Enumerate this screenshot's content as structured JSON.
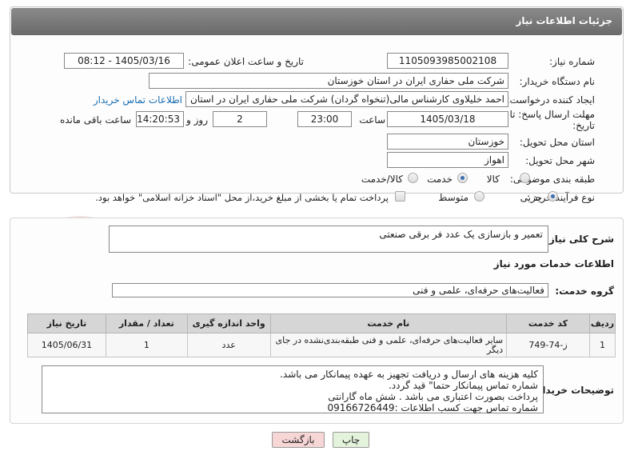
{
  "header": {
    "title": "جزئیات اطلاعات نیاز"
  },
  "form": {
    "need_number_label": "شماره نیاز:",
    "need_number": "1105093985002108",
    "announce_label": "تاریخ و ساعت اعلان عمومی:",
    "announce_value": "1405/03/16 - 08:12",
    "buyer_org_label": "نام دستگاه خریدار:",
    "buyer_org": "شرکت ملی حفاری ایران در استان خوزستان",
    "requester_label": "ایجاد کننده درخواست:",
    "requester": "احمد خلیلاوی کارشناس مالی(تنخواه گردان) شرکت ملی حفاری ایران در استان",
    "buyer_contact_link": "اطلاعات تماس خریدار",
    "deadline_label_1": "مهلت ارسال پاسخ: تا",
    "deadline_label_2": "تاریخ:",
    "deadline_date": "1405/03/18",
    "time_label": "ساعت",
    "deadline_time": "23:00",
    "days_value": "2",
    "days_label": "روز و",
    "remaining_time": "14:20:53",
    "remaining_label": "ساعت باقی مانده",
    "province_label": "استان محل تحویل:",
    "province": "خوزستان",
    "city_label": "شهر محل تحویل:",
    "city": "اهواز",
    "category_label": "طبقه بندی موضوعی:",
    "category_options": [
      "کالا",
      "خدمت",
      "کالا/خدمت"
    ],
    "category_selected": "خدمت",
    "purchase_label": "نوع فرآیند خرید :",
    "purchase_options": [
      "جزیی",
      "متوسط"
    ],
    "purchase_selected": "جزیی",
    "payment_note": "پرداخت تمام یا بخشی از مبلغ خرید،از محل \"اسناد خزانه اسلامی\" خواهد بود."
  },
  "details": {
    "summary_label": "شرح کلی نیاز:",
    "summary": "تعمیر و بازسازی یک عدد فر برقی صنعتی",
    "services_title": "اطلاعات خدمات مورد نیاز",
    "service_group_label": "گروه خدمت:",
    "service_group": "فعالیت‌های حرفه‌ای، علمی و فنی",
    "table": {
      "headers": [
        "ردیف",
        "کد خدمت",
        "نام خدمت",
        "واحد اندازه گیری",
        "تعداد / مقدار",
        "تاریخ نیاز"
      ],
      "rows": [
        [
          "1",
          "ز-74-749",
          "سایر فعالیت‌های حرفه‌ای، علمی و فنی طبقه‌بندی‌نشده در جای دیگر",
          "عدد",
          "1",
          "1405/06/31"
        ]
      ]
    },
    "buyer_notes_label": "توضیحات خریدار:",
    "buyer_notes": [
      "کلیه هزینه های ارسال و دریافت تجهیز به عهده پیمانکار می باشد.",
      "شماره تماس پیمانکار حتما\" قید گردد.",
      "پرداخت بصورت اعتباری می باشد . شش ماه گارانتی",
      "شماره تماس جهت کسب اطلاعات :09166726449"
    ]
  },
  "buttons": {
    "print": "چاپ",
    "back": "بازگشت"
  },
  "watermark": {
    "text": "AriaTender.neT"
  },
  "colors": {
    "header_bg": "#7a7a7a",
    "link": "#1a6fb4",
    "back_button_bg": "#f7d6d6",
    "print_button_bg": "#e4f3dc"
  }
}
